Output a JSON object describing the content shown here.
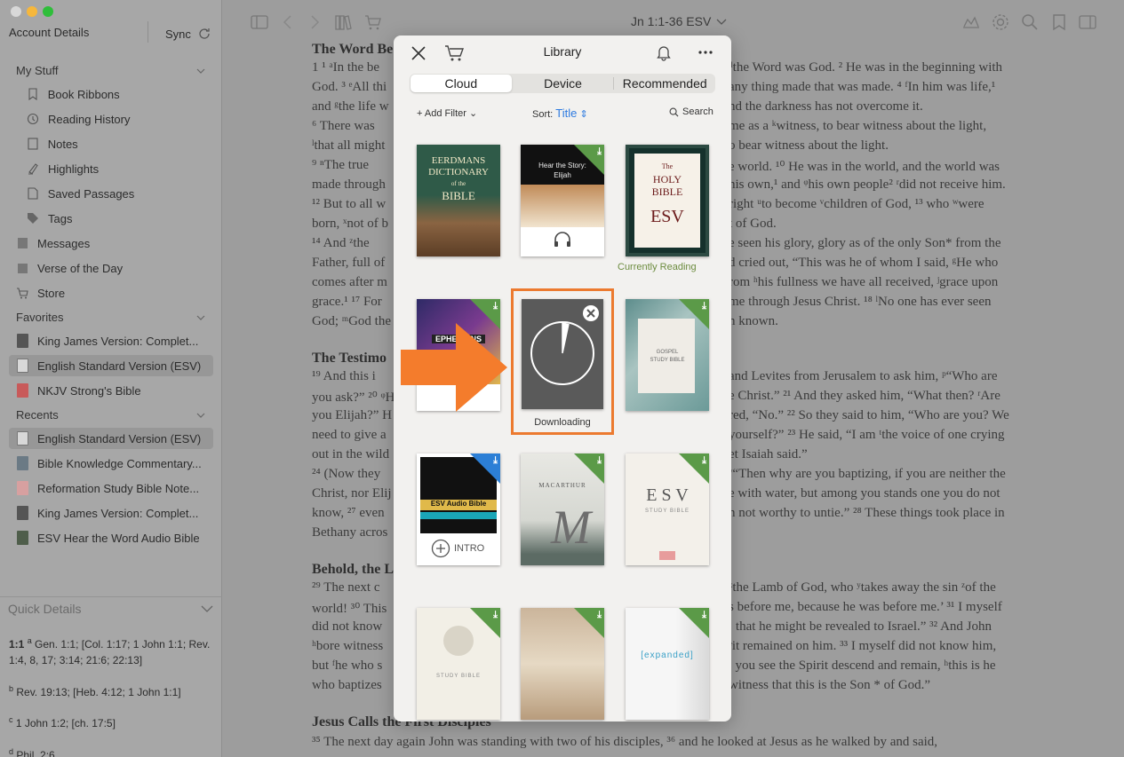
{
  "window": {
    "account_label": "Account Details",
    "sync_label": "Sync"
  },
  "sidebar": {
    "my_stuff": "My Stuff",
    "my_stuff_items": [
      "Book Ribbons",
      "Reading History",
      "Notes",
      "Highlights",
      "Saved Passages",
      "Tags"
    ],
    "top_items": [
      "Messages",
      "Verse of the Day",
      "Store"
    ],
    "favorites": "Favorites",
    "favorite_items": [
      "King James Version: Complet...",
      "English Standard Version (ESV)",
      "NKJV Strong's Bible"
    ],
    "recents": "Recents",
    "recent_items": [
      "English Standard Version (ESV)",
      "Bible Knowledge Commentary...",
      "Reformation Study Bible Note...",
      "King James Version: Complet...",
      "ESV Hear the Word Audio Bible"
    ]
  },
  "quick_details": {
    "title": "Quick Details",
    "rows": [
      {
        "ref": "1:1",
        "sup": "a",
        "text": "Gen. 1:1; [Col. 1:17; 1 John 1:1; Rev. 1:4, 8, 17; 3:14; 21:6; 22:13]"
      },
      {
        "ref": "",
        "sup": "b",
        "text": "Rev. 19:13; [Heb. 4:12; 1 John 1:1]"
      },
      {
        "ref": "",
        "sup": "c",
        "text": "1 John 1:2; [ch. 17:5]"
      },
      {
        "ref": "",
        "sup": "d",
        "text": "Phil. 2:6"
      }
    ]
  },
  "toolbar": {
    "reference": "Jn 1:1-36  ESV"
  },
  "reader": {
    "heading1": "The Word Be",
    "lines_left": [
      "1  ¹ ᵃIn the be",
      "God. ³ ᵉAll thi",
      "and ᵍthe life w",
      "   ⁶ There was",
      "ˡthat all might",
      "   ⁹ ⁿThe true",
      "made through",
      "¹² But to all w",
      "born, ˣnot of b",
      "   ¹⁴ And  ᶻthe",
      "Father, full of",
      "comes after m",
      "grace.¹ ¹⁷ For",
      "God; ᵐGod the"
    ],
    "lines_right": [
      "ᵈthe Word was God. ² He was in the beginning with",
      "any thing made that was made. ⁴ ᶠIn him was life,¹",
      "nd the darkness has not overcome it.",
      "me as a  ᵏwitness, to bear witness about the light,",
      "o bear witness about the light.",
      "e world. ¹⁰ He was in the world, and the world was",
      "his own,¹ and ᵠhis own people² ʳdid not receive him.",
      "right ᵘto become ᵛchildren of God, ¹³ who  ʷwere",
      "t of God.",
      "e seen his glory, glory as of the only Son* from the",
      "d cried out, “This was he of whom I said, ᵍHe who",
      "rom  ʰhis fullness we have all received, ʲgrace upon",
      "me through Jesus Christ. ¹⁸ ˡNo one has ever seen",
      "n known."
    ],
    "heading2": "The Testimo",
    "lines2_left": [
      "   ¹⁹ And this i",
      "you ask?” ²⁰ ᵠHe c",
      "you Elijah?” H",
      "need to give a",
      "out in the wild",
      "   ²⁴ (Now they",
      "Christ, nor Elij",
      "know, ²⁷ even",
      "Bethany acros"
    ],
    "lines2_right": [
      "and Levites from Jerusalem to ask him, ᵖ“Who are",
      "e Christ.” ²¹ And they asked him, “What then?  ʳAre",
      "red, “No.” ²² So they said to him, “Who are you? We",
      "yourself?” ²³ He said, “I am  ᵗthe voice of one crying",
      "et Isaiah said.”",
      "ᵛ“Then why are you baptizing, if you are neither the",
      "e with water, but among you stands one you do not",
      "n not worthy to untie.” ²⁸ These things took place in",
      ""
    ],
    "heading3": "Behold, the L",
    "lines3_left": [
      "   ²⁹ The next c",
      "world! ³⁰ This",
      "did not know",
      "ʰbore witness",
      "but  ᶠhe who s",
      "who baptizes"
    ],
    "lines3_right": [
      "ˣthe Lamb of God, who ʸtakes away the sin ᶻof the",
      "s before me, because he was before me.’ ³¹ I myself",
      "; that he might be revealed to Israel.” ³² And John",
      "ᵉit remained on him. ³³ I myself did not know him,",
      ", you see the Spirit descend and remain, ʰthis is he",
      "witness that this is the Son *  of God.”"
    ],
    "heading4": "Jesus Calls the First Disciples",
    "line4": "³⁵ The next day again John was standing with two of his disciples, ³⁶ and he looked at Jesus as he walked by and said,"
  },
  "library": {
    "title": "Library",
    "tabs": [
      "Cloud",
      "Device",
      "Recommended"
    ],
    "add_filter": "+ Add Filter",
    "sort_label": "Sort:",
    "sort_value": "Title",
    "search": "Search",
    "currently_reading": "Currently Reading",
    "downloading": "Downloading",
    "books": {
      "eerdmans": [
        "EERDMANS",
        "DICTIONARY",
        "of the",
        "BIBLE"
      ],
      "elijah": [
        "Hear the Story:",
        "Elijah"
      ],
      "holy_bible": [
        "The",
        "HOLY",
        "BIBLE",
        "ESV"
      ],
      "ephesians": "EPHESIANS",
      "gospel": [
        "GOSPEL",
        "STUDY BIBLE"
      ],
      "esv_audio": [
        "ESV Audio Bible",
        "INTRO"
      ],
      "macarthur": "MACARTHUR",
      "esv_study": [
        "E S V",
        "STUDY BIBLE"
      ],
      "study_bible": "STUDY BIBLE",
      "expanded": "[expanded]"
    }
  }
}
